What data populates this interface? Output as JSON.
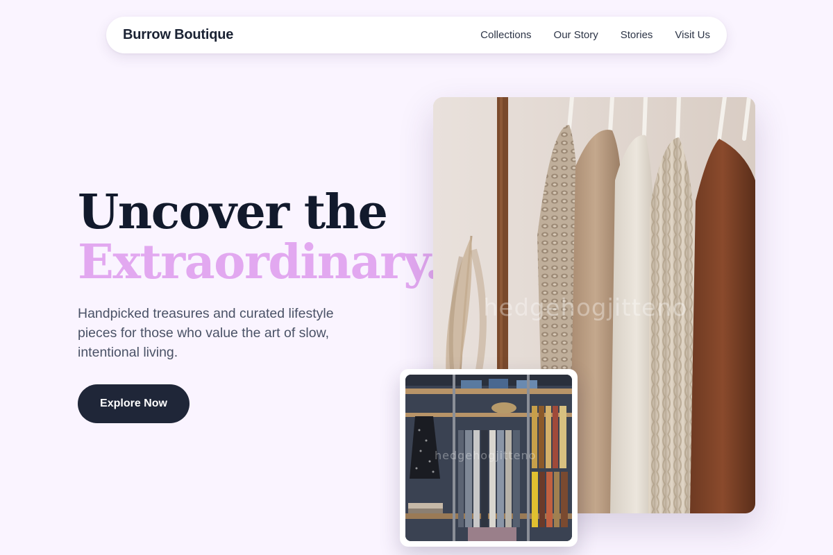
{
  "nav": {
    "brand": "Burrow Boutique",
    "links": [
      "Collections",
      "Our Story",
      "Stories",
      "Visit Us"
    ]
  },
  "hero": {
    "headline_line1": "Uncover the",
    "headline_line2": "Extraordinary.",
    "subtitle": "Handpicked treasures and curated lifestyle pieces for those who value the art of slow, intentional living.",
    "cta_label": "Explore Now"
  },
  "images": {
    "main": "clothing-rack-photo",
    "secondary": "boutique-shelves-photo"
  },
  "colors": {
    "background": "#faf4ff",
    "headline": "#121a2c",
    "accent": "#e2a8f0",
    "button": "#1f2638",
    "body_text": "#4a5266"
  }
}
